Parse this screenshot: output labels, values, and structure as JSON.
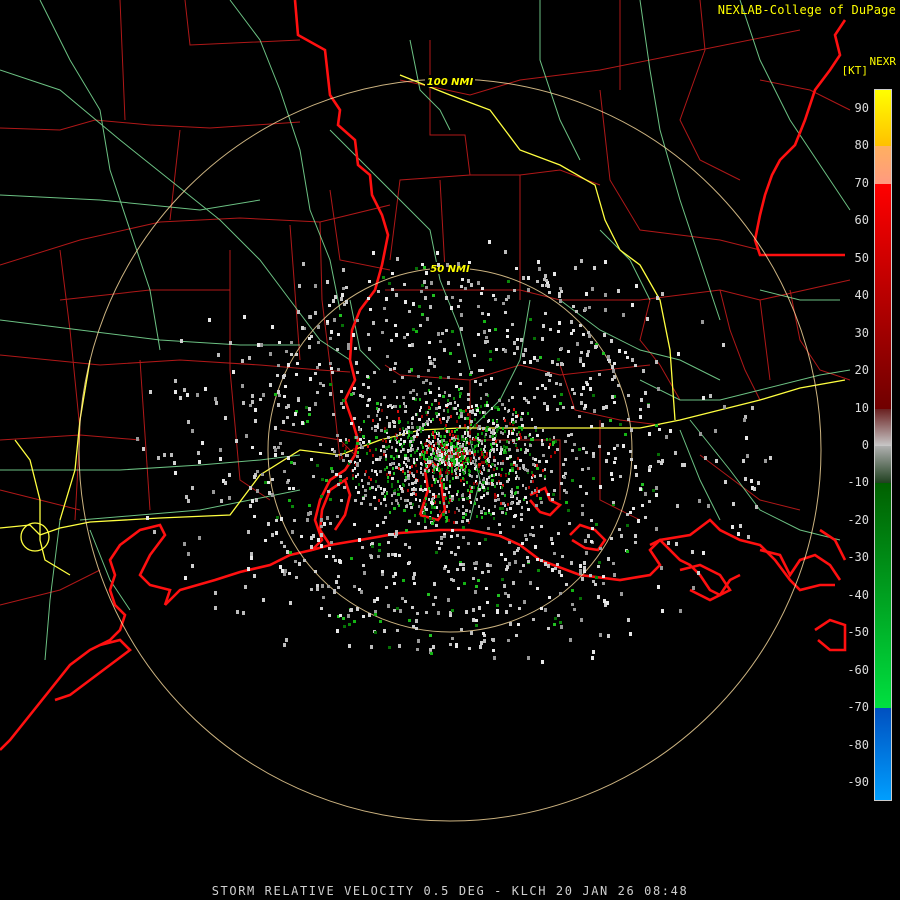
{
  "credit": "NEXLAB-College of DuPage",
  "product_label": "NEXR",
  "units_label": "[KT]",
  "footer": "STORM RELATIVE VELOCITY 0.5 DEG - KLCH 20 JAN 26 08:48",
  "range_rings": [
    {
      "label": "50 NMI"
    },
    {
      "label": "100 NMI"
    }
  ],
  "velocity_scale": {
    "ticks": [
      "90",
      "80",
      "70",
      "60",
      "50",
      "40",
      "30",
      "20",
      "10",
      "0",
      "-10",
      "-20",
      "-30",
      "-40",
      "-50",
      "-60",
      "-70",
      "-80",
      "-90"
    ],
    "bands": [
      {
        "from": 90,
        "to": 80,
        "color": "#ffff00",
        "color2": "#ffc000"
      },
      {
        "from": 80,
        "to": 70,
        "color": "#ffb060",
        "color2": "#ff9a80"
      },
      {
        "from": 70,
        "to": 10,
        "color": "#ff0000",
        "color2": "#700000"
      },
      {
        "from": 10,
        "to": 0,
        "color": "#6a2020",
        "color2": "#c8c8c8"
      },
      {
        "from": 0,
        "to": -10,
        "color": "#b0b0b0",
        "color2": "#204020"
      },
      {
        "from": -10,
        "to": -70,
        "color": "#006000",
        "color2": "#00e040"
      },
      {
        "from": -70,
        "to": -90,
        "color": "#0050c0",
        "color2": "#00a0ff"
      }
    ]
  },
  "colors": {
    "state_border": "#ff1010",
    "county_border": "#b01818",
    "highway": "#7fe39a",
    "interstate": "#ffff40",
    "range_ring": "#ffe0a0"
  }
}
